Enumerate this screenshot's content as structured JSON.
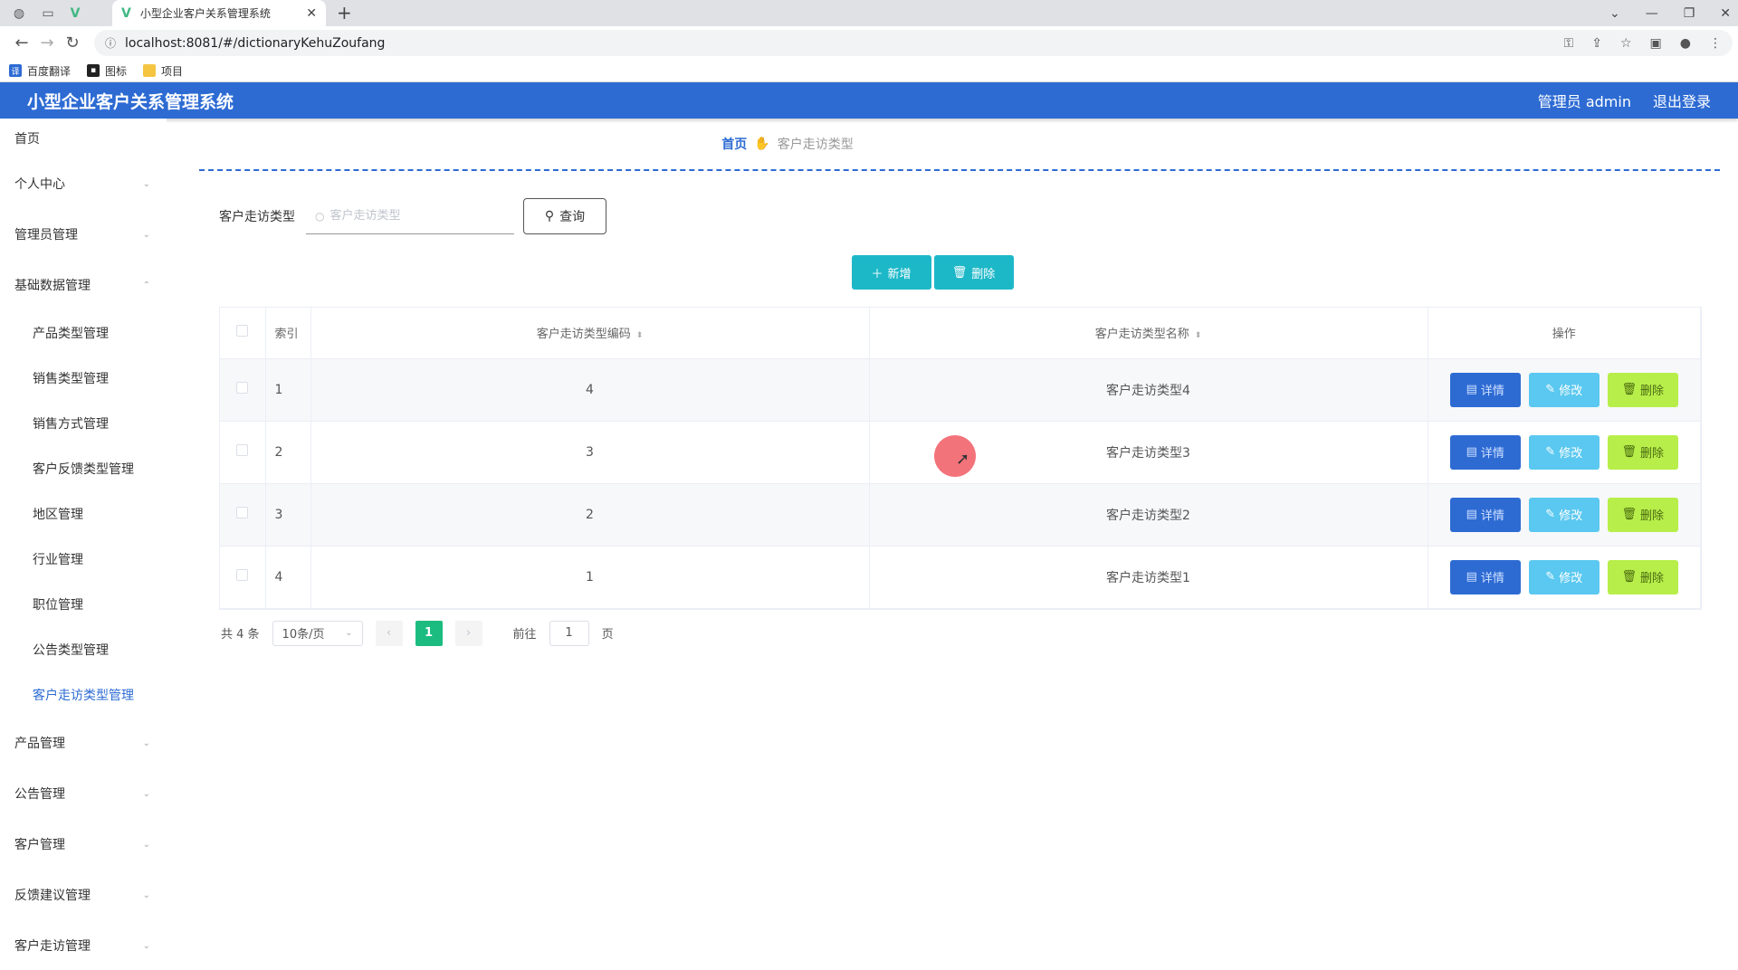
{
  "browser": {
    "tab_title": "小型企业客户关系管理系统",
    "url": "localhost:8081/#/dictionaryKehuZoufang",
    "bookmarks": [
      {
        "label": "百度翻译",
        "icon": "translate-icon",
        "color": "#2d6bd3"
      },
      {
        "label": "图标",
        "icon": "image-icon",
        "color": "#222222"
      },
      {
        "label": "项目",
        "icon": "folder-icon",
        "color": "#f5c542"
      }
    ]
  },
  "header": {
    "title": "小型企业客户关系管理系统",
    "user": "管理员 admin",
    "logout": "退出登录",
    "color": "#2d6bd3"
  },
  "sidebar": {
    "items": [
      {
        "label": "首页"
      },
      {
        "label": "个人中心"
      },
      {
        "label": "管理员管理"
      },
      {
        "label": "基础数据管理"
      },
      {
        "label": "产品管理"
      },
      {
        "label": "公告管理"
      },
      {
        "label": "客户管理"
      },
      {
        "label": "反馈建议管理"
      },
      {
        "label": "客户走访管理"
      }
    ],
    "sub_items": [
      {
        "label": "产品类型管理"
      },
      {
        "label": "销售类型管理"
      },
      {
        "label": "销售方式管理"
      },
      {
        "label": "客户反馈类型管理"
      },
      {
        "label": "地区管理"
      },
      {
        "label": "行业管理"
      },
      {
        "label": "职位管理"
      },
      {
        "label": "公告类型管理"
      },
      {
        "label": "客户走访类型管理"
      }
    ]
  },
  "breadcrumb": {
    "home": "首页",
    "current": "客户走访类型"
  },
  "search": {
    "label": "客户走访类型",
    "placeholder": "客户走访类型",
    "button": "查询"
  },
  "actions": {
    "add": "新增",
    "delete": "删除"
  },
  "table": {
    "headers": {
      "index": "索引",
      "code": "客户走访类型编码",
      "name": "客户走访类型名称",
      "ops": "操作"
    },
    "rows": [
      {
        "index": "1",
        "code": "4",
        "name": "客户走访类型4"
      },
      {
        "index": "2",
        "code": "3",
        "name": "客户走访类型3"
      },
      {
        "index": "3",
        "code": "2",
        "name": "客户走访类型2"
      },
      {
        "index": "4",
        "code": "1",
        "name": "客户走访类型1"
      }
    ],
    "op_labels": {
      "detail": "详情",
      "edit": "修改",
      "delete": "删除"
    }
  },
  "pagination": {
    "total": "共 4 条",
    "page_size": "10条/页",
    "current_page": "1",
    "goto_label": "前往",
    "goto_value": "1",
    "page_suffix": "页"
  }
}
